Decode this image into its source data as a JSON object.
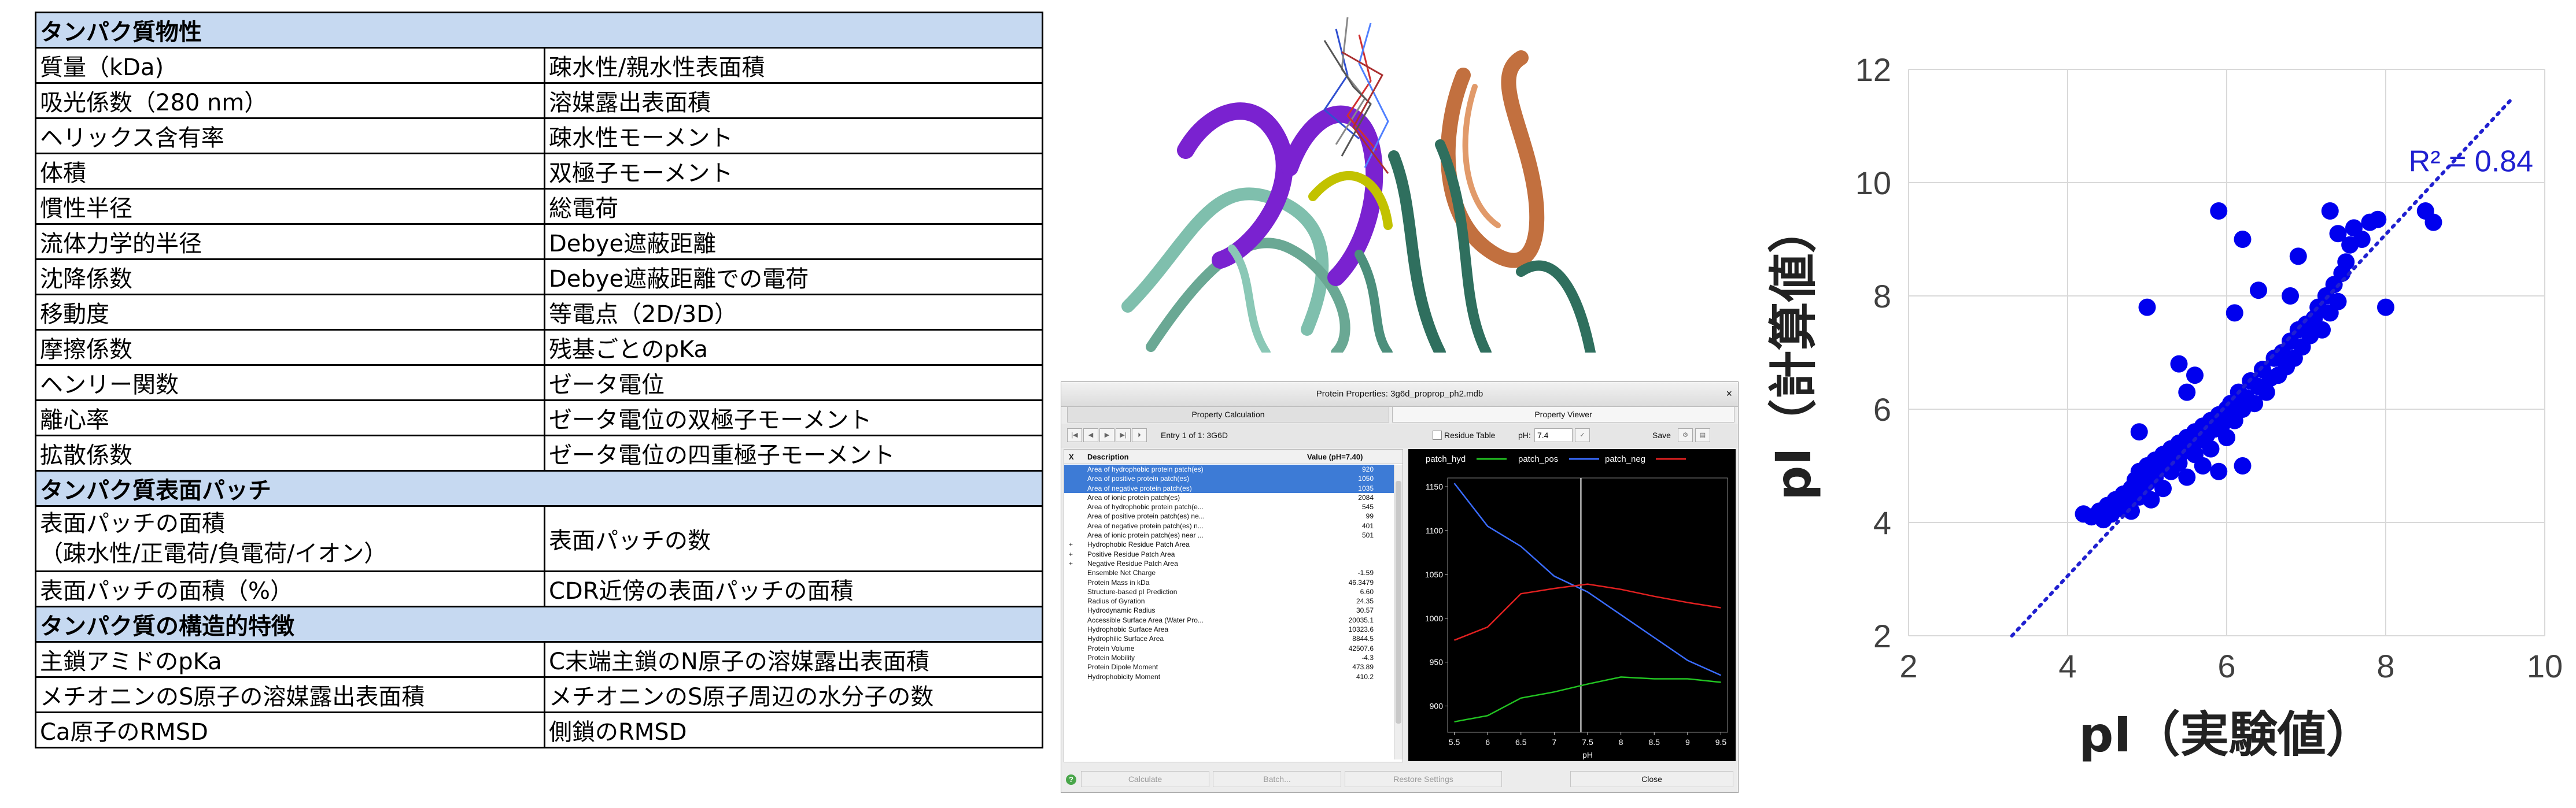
{
  "property_table": {
    "rows": [
      {
        "type": "section",
        "c1": "タンパク質物性"
      },
      {
        "c1": "質量（kDa)",
        "c2": "疎水性/親水性表面積"
      },
      {
        "c1": "吸光係数（280 nm）",
        "c2": "溶媒露出表面積"
      },
      {
        "c1": "ヘリックス含有率",
        "c2": "疎水性モーメント"
      },
      {
        "c1": "体積",
        "c2": "双極子モーメント"
      },
      {
        "c1": "慣性半径",
        "c2": "総電荷"
      },
      {
        "c1": "流体力学的半径",
        "c2": "Debye遮蔽距離"
      },
      {
        "c1": "沈降係数",
        "c2": "Debye遮蔽距離での電荷"
      },
      {
        "c1": "移動度",
        "c2": "等電点（2D/3D）"
      },
      {
        "c1": "摩擦係数",
        "c2": "残基ごとのpKa"
      },
      {
        "c1": "ヘンリー関数",
        "c2": "ゼータ電位"
      },
      {
        "c1": "離心率",
        "c2": "ゼータ電位の双極子モーメント"
      },
      {
        "c1": "拡散係数",
        "c2": "ゼータ電位の四重極子モーメント"
      },
      {
        "type": "section",
        "c1": "タンパク質表面パッチ"
      },
      {
        "type": "tall",
        "c1a": "表面パッチの面積",
        "c1b": "（疎水性/正電荷/負電荷/イオン）",
        "c2": "表面パッチの数"
      },
      {
        "c1": "表面パッチの面積（%）",
        "c2": "CDR近傍の表面パッチの面積"
      },
      {
        "type": "section",
        "c1": "タンパク質の構造的特徴"
      },
      {
        "c1": "主鎖アミドのpKa",
        "c2": "C末端主鎖のN原子の溶媒露出表面積"
      },
      {
        "c1": "メチオニンのS原子の溶媒露出表面積",
        "c2": "メチオニンのS原子周辺の水分子の数"
      },
      {
        "c1": "Ca原子のRMSD",
        "c2": "側鎖のRMSD"
      }
    ]
  },
  "app": {
    "title": "Protein Properties: 3g6d_proprop_ph2.mdb",
    "close_glyph": "×",
    "tabs": [
      "Property Calculation",
      "Property Viewer"
    ],
    "entry_text": "Entry 1 of 1: 3G6D",
    "residue_table_label": "Residue Table",
    "ph_label": "pH:",
    "ph_value": "7.4",
    "save_label": "Save",
    "nav_glyphs": [
      "|◀",
      "◀",
      "▶",
      "▶|",
      "⏵"
    ],
    "list_headers": {
      "x": "X",
      "description": "Description",
      "value": "Value (pH=7.40)"
    },
    "rows": [
      {
        "exp": "",
        "d": "Area of hydrophobic protein patch(es)",
        "v": "920",
        "sel": true
      },
      {
        "exp": "",
        "d": "Area of positive protein patch(es)",
        "v": "1050",
        "sel": true
      },
      {
        "exp": "",
        "d": "Area of negative protein patch(es)",
        "v": "1035",
        "sel": true
      },
      {
        "exp": "",
        "d": "Area of ionic protein patch(es)",
        "v": "2084"
      },
      {
        "exp": "",
        "d": "Area of hydrophobic protein patch(e...",
        "v": "545"
      },
      {
        "exp": "",
        "d": "Area of positive protein patch(es) ne...",
        "v": "99"
      },
      {
        "exp": "",
        "d": "Area of negative protein patch(es) n...",
        "v": "401"
      },
      {
        "exp": "",
        "d": "Area of ionic protein patch(es) near ...",
        "v": "501"
      },
      {
        "exp": "+",
        "d": "Hydrophobic Residue Patch Area",
        "v": ""
      },
      {
        "exp": "+",
        "d": "Positive Residue Patch Area",
        "v": ""
      },
      {
        "exp": "+",
        "d": "Negative Residue Patch Area",
        "v": ""
      },
      {
        "exp": "",
        "d": "Ensemble Net Charge",
        "v": "-1.59"
      },
      {
        "exp": "",
        "d": "Protein Mass in kDa",
        "v": "46.3479"
      },
      {
        "exp": "",
        "d": "Structure-based pI Prediction",
        "v": "6.60"
      },
      {
        "exp": "",
        "d": "Radius of Gyration",
        "v": "24.35"
      },
      {
        "exp": "",
        "d": "Hydrodynamic Radius",
        "v": "30.57"
      },
      {
        "exp": "",
        "d": "Accessible Surface Area (Water Pro...",
        "v": "20035.1"
      },
      {
        "exp": "",
        "d": "Hydrophobic Surface Area",
        "v": "10323.6"
      },
      {
        "exp": "",
        "d": "Hydrophilic Surface Area",
        "v": "8844.5"
      },
      {
        "exp": "",
        "d": "Protein Volume",
        "v": "42507.6"
      },
      {
        "exp": "",
        "d": "Protein Mobility",
        "v": "-4.3"
      },
      {
        "exp": "",
        "d": "Protein Dipole Moment",
        "v": "473.89"
      },
      {
        "exp": "",
        "d": "Hydrophobicity Moment",
        "v": "410.2"
      }
    ],
    "buttons": [
      "Calculate",
      "Batch...",
      "Restore Settings",
      "Close"
    ],
    "help_glyph": "?"
  },
  "colors": {
    "section_bg": "#c6d9f1",
    "scatter_point": "#0000ee",
    "trend": "#2020d0",
    "patch_hyd": "#22c322",
    "patch_pos": "#3a6cff",
    "patch_neg": "#e02020"
  },
  "chart_data": [
    {
      "type": "line",
      "legend": [
        "patch_hyd",
        "patch_pos",
        "patch_neg"
      ],
      "legend_position": "top",
      "xlabel": "pH",
      "ylabel": "",
      "xlim": [
        5.4,
        9.6
      ],
      "ylim": [
        870,
        1160
      ],
      "x_ticks": [
        "5.5",
        "6",
        "6.5",
        "7",
        "7.5",
        "8",
        "8.5",
        "9",
        "9.5"
      ],
      "y_ticks": [
        "900",
        "950",
        "1000",
        "1050",
        "1100",
        "1150"
      ],
      "marker_x": 7.4,
      "x": [
        5.5,
        6.0,
        6.5,
        7.0,
        7.5,
        8.0,
        8.5,
        9.0,
        9.5
      ],
      "series": [
        {
          "name": "patch_hyd",
          "values": [
            882,
            889,
            909,
            916,
            925,
            933,
            931,
            931,
            927
          ]
        },
        {
          "name": "patch_pos",
          "values": [
            1154,
            1105,
            1082,
            1048,
            1030,
            1004,
            978,
            952,
            935
          ]
        },
        {
          "name": "patch_neg",
          "values": [
            975,
            990,
            1028,
            1034,
            1039,
            1033,
            1025,
            1018,
            1012
          ]
        }
      ]
    },
    {
      "type": "scatter",
      "xlabel": "pI（実験値）",
      "ylabel": "pI（計算値）",
      "xlim": [
        2,
        10
      ],
      "ylim": [
        2,
        12
      ],
      "x_ticks": [
        "2",
        "4",
        "6",
        "8",
        "10"
      ],
      "y_ticks": [
        "2",
        "4",
        "6",
        "8",
        "10",
        "12"
      ],
      "grid": true,
      "trend_annotation": "R² = 0.84",
      "trend_line": {
        "x": [
          3.3,
          9.6
        ],
        "y": [
          2.0,
          11.5
        ]
      },
      "points": [
        [
          4.2,
          4.15
        ],
        [
          4.3,
          4.1
        ],
        [
          4.4,
          4.2
        ],
        [
          4.45,
          4.05
        ],
        [
          4.5,
          4.3
        ],
        [
          4.55,
          4.15
        ],
        [
          4.6,
          4.4
        ],
        [
          4.65,
          4.25
        ],
        [
          4.7,
          4.5
        ],
        [
          4.75,
          4.35
        ],
        [
          4.8,
          4.6
        ],
        [
          4.8,
          4.2
        ],
        [
          4.85,
          4.75
        ],
        [
          4.9,
          4.45
        ],
        [
          4.9,
          4.9
        ],
        [
          4.95,
          4.6
        ],
        [
          5.0,
          5.0
        ],
        [
          5.0,
          4.7
        ],
        [
          5.05,
          4.4
        ],
        [
          5.1,
          5.1
        ],
        [
          5.1,
          4.8
        ],
        [
          5.15,
          4.95
        ],
        [
          5.2,
          5.2
        ],
        [
          5.2,
          4.6
        ],
        [
          5.25,
          5.0
        ],
        [
          5.3,
          5.3
        ],
        [
          5.3,
          4.9
        ],
        [
          5.35,
          5.15
        ],
        [
          5.4,
          5.4
        ],
        [
          5.4,
          5.05
        ],
        [
          5.45,
          5.25
        ],
        [
          5.5,
          5.5
        ],
        [
          5.5,
          4.8
        ],
        [
          5.55,
          5.35
        ],
        [
          5.6,
          5.6
        ],
        [
          5.6,
          5.2
        ],
        [
          5.65,
          5.45
        ],
        [
          5.7,
          5.7
        ],
        [
          5.7,
          5.0
        ],
        [
          5.75,
          5.55
        ],
        [
          5.8,
          5.8
        ],
        [
          5.8,
          5.3
        ],
        [
          5.85,
          5.65
        ],
        [
          5.9,
          5.9
        ],
        [
          5.9,
          4.9
        ],
        [
          5.95,
          5.75
        ],
        [
          6.0,
          6.0
        ],
        [
          6.0,
          5.5
        ],
        [
          6.05,
          6.1
        ],
        [
          6.1,
          5.8
        ],
        [
          6.15,
          6.3
        ],
        [
          6.2,
          6.0
        ],
        [
          6.25,
          6.2
        ],
        [
          6.3,
          6.5
        ],
        [
          6.35,
          6.1
        ],
        [
          6.4,
          6.4
        ],
        [
          6.45,
          6.7
        ],
        [
          6.5,
          6.3
        ],
        [
          6.55,
          6.55
        ],
        [
          6.6,
          6.9
        ],
        [
          6.65,
          6.6
        ],
        [
          6.7,
          7.0
        ],
        [
          6.75,
          6.75
        ],
        [
          6.8,
          7.2
        ],
        [
          6.85,
          6.9
        ],
        [
          6.9,
          7.4
        ],
        [
          6.95,
          7.1
        ],
        [
          7.0,
          7.5
        ],
        [
          7.05,
          7.3
        ],
        [
          7.1,
          7.6
        ],
        [
          7.15,
          7.8
        ],
        [
          7.2,
          7.4
        ],
        [
          7.25,
          8.0
        ],
        [
          7.3,
          7.7
        ],
        [
          7.35,
          8.2
        ],
        [
          7.4,
          7.9
        ],
        [
          7.45,
          8.4
        ],
        [
          7.5,
          8.6
        ],
        [
          7.55,
          8.9
        ],
        [
          7.6,
          9.2
        ],
        [
          7.7,
          9.0
        ],
        [
          7.8,
          9.3
        ],
        [
          7.9,
          9.35
        ],
        [
          6.8,
          8.0
        ],
        [
          6.4,
          8.1
        ],
        [
          5.9,
          9.5
        ],
        [
          6.2,
          9.0
        ],
        [
          5.4,
          6.8
        ],
        [
          5.0,
          7.8
        ],
        [
          6.1,
          7.7
        ],
        [
          8.0,
          7.8
        ],
        [
          8.5,
          9.5
        ],
        [
          8.6,
          9.3
        ],
        [
          7.3,
          9.5
        ],
        [
          7.4,
          9.1
        ],
        [
          6.9,
          8.7
        ],
        [
          6.2,
          5.0
        ],
        [
          5.5,
          6.3
        ],
        [
          5.6,
          6.6
        ],
        [
          4.9,
          5.6
        ]
      ]
    }
  ]
}
